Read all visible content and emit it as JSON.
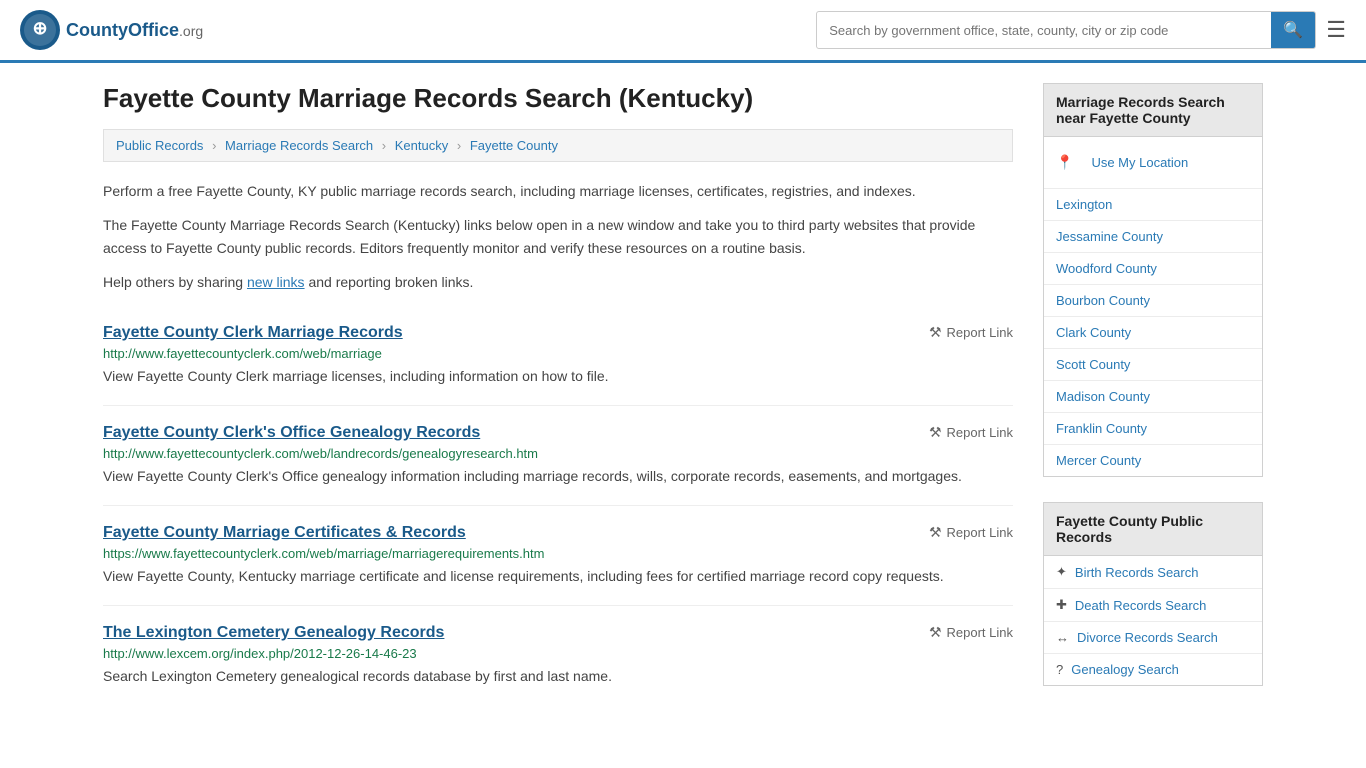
{
  "header": {
    "logo_text": "CountyOffice",
    "logo_suffix": ".org",
    "search_placeholder": "Search by government office, state, county, city or zip code",
    "search_button_icon": "🔍"
  },
  "page": {
    "title": "Fayette County Marriage Records Search (Kentucky)",
    "breadcrumb": [
      {
        "label": "Public Records",
        "href": "#"
      },
      {
        "label": "Marriage Records Search",
        "href": "#"
      },
      {
        "label": "Kentucky",
        "href": "#"
      },
      {
        "label": "Fayette County",
        "href": "#"
      }
    ],
    "description1": "Perform a free Fayette County, KY public marriage records search, including marriage licenses, certificates, registries, and indexes.",
    "description2": "The Fayette County Marriage Records Search (Kentucky) links below open in a new window and take you to third party websites that provide access to Fayette County public records. Editors frequently monitor and verify these resources on a routine basis.",
    "description3_prefix": "Help others by sharing ",
    "description3_link": "new links",
    "description3_suffix": " and reporting broken links."
  },
  "records": [
    {
      "title": "Fayette County Clerk Marriage Records",
      "url": "http://www.fayettecountyclerk.com/web/marriage",
      "description": "View Fayette County Clerk marriage licenses, including information on how to file.",
      "report_label": "Report Link"
    },
    {
      "title": "Fayette County Clerk's Office Genealogy Records",
      "url": "http://www.fayettecountyclerk.com/web/landrecords/genealogyresearch.htm",
      "description": "View Fayette County Clerk's Office genealogy information including marriage records, wills, corporate records, easements, and mortgages.",
      "report_label": "Report Link"
    },
    {
      "title": "Fayette County Marriage Certificates & Records",
      "url": "https://www.fayettecountyclerk.com/web/marriage/marriagerequirements.htm",
      "description": "View Fayette County, Kentucky marriage certificate and license requirements, including fees for certified marriage record copy requests.",
      "report_label": "Report Link"
    },
    {
      "title": "The Lexington Cemetery Genealogy Records",
      "url": "http://www.lexcem.org/index.php/2012-12-26-14-46-23",
      "description": "Search Lexington Cemetery genealogical records database by first and last name.",
      "report_label": "Report Link"
    }
  ],
  "sidebar": {
    "nearby_heading": "Marriage Records Search near Fayette County",
    "use_location_label": "Use My Location",
    "nearby_counties": [
      {
        "label": "Lexington"
      },
      {
        "label": "Jessamine County"
      },
      {
        "label": "Woodford County"
      },
      {
        "label": "Bourbon County"
      },
      {
        "label": "Clark County"
      },
      {
        "label": "Scott County"
      },
      {
        "label": "Madison County"
      },
      {
        "label": "Franklin County"
      },
      {
        "label": "Mercer County"
      }
    ],
    "public_records_heading": "Fayette County Public Records",
    "public_records": [
      {
        "label": "Birth Records Search",
        "icon": "✦"
      },
      {
        "label": "Death Records Search",
        "icon": "✚"
      },
      {
        "label": "Divorce Records Search",
        "icon": "↔"
      },
      {
        "label": "Genealogy Search",
        "icon": "?"
      }
    ]
  }
}
